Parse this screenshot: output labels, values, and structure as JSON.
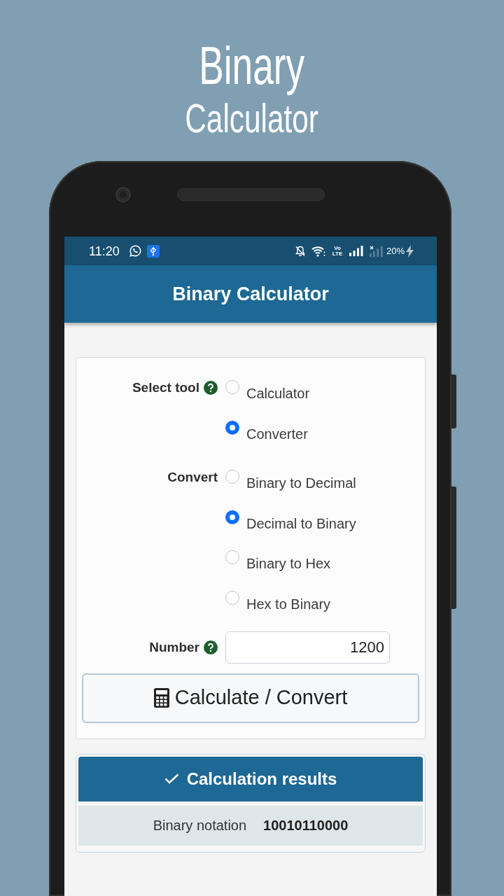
{
  "promo": {
    "line_1": "Binary",
    "line_2": "Calculator"
  },
  "status_bar": {
    "time": "11:20",
    "volte_label": "Vo LTE",
    "battery_percent": "20%"
  },
  "app_bar": {
    "title": "Binary Calculator"
  },
  "form": {
    "groups": [
      {
        "label": "Select tool",
        "help": true,
        "options": [
          {
            "label": "Calculator",
            "selected": false
          },
          {
            "label": "Converter",
            "selected": true
          }
        ]
      },
      {
        "label": "Convert",
        "help": false,
        "options": [
          {
            "label": "Binary to Decimal",
            "selected": false
          },
          {
            "label": "Decimal to Binary",
            "selected": true
          },
          {
            "label": "Binary to Hex",
            "selected": false
          },
          {
            "label": "Hex to Binary",
            "selected": false
          }
        ]
      }
    ],
    "number": {
      "label": "Number",
      "help": true,
      "value": "1200"
    },
    "submit": {
      "label": "Calculate / Convert"
    }
  },
  "results": {
    "title": "Calculation results",
    "rows": [
      {
        "label": "Binary notation",
        "value": "10010110000"
      }
    ]
  }
}
